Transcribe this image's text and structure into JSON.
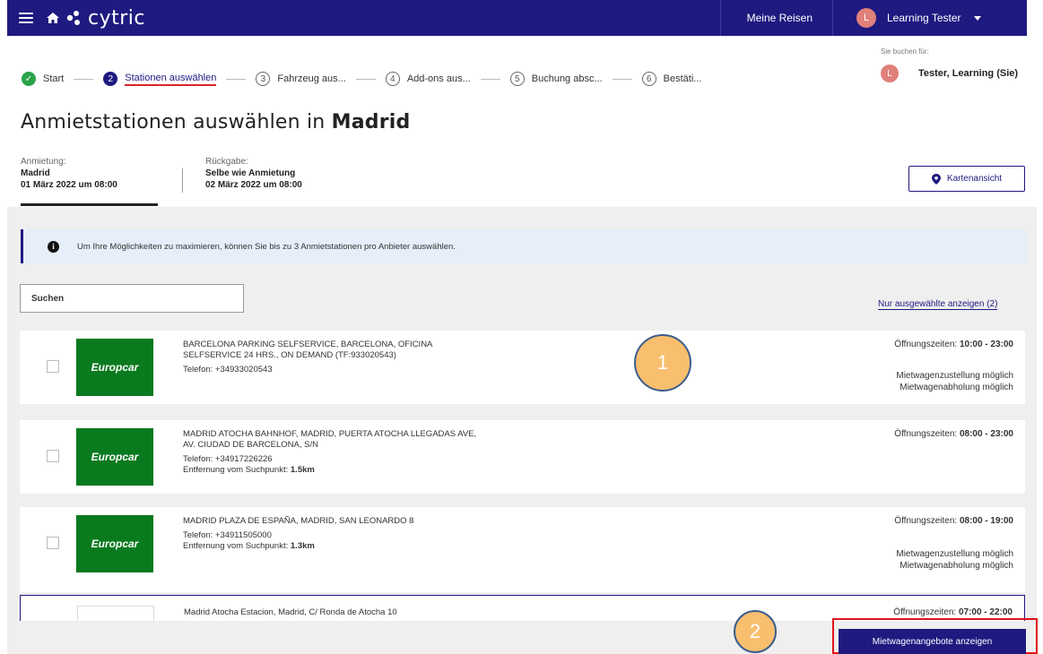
{
  "topbar": {
    "logo_text": "cytric",
    "trips_label": "Meine Reisen",
    "user_initial": "L",
    "user_name": "Learning Tester",
    "bg_color": "#1e1a80"
  },
  "stepper": {
    "steps": [
      {
        "num": "✓",
        "label": "Start",
        "state": "done"
      },
      {
        "num": "2",
        "label": "Stationen auswählen",
        "state": "active"
      },
      {
        "num": "3",
        "label": "Fahrzeug aus...",
        "state": "todo"
      },
      {
        "num": "4",
        "label": "Add-ons aus...",
        "state": "todo"
      },
      {
        "num": "5",
        "label": "Buchung absc...",
        "state": "todo"
      },
      {
        "num": "6",
        "label": "Bestäti...",
        "state": "todo"
      }
    ]
  },
  "booking_for": {
    "caption": "Sie buchen für:",
    "initial": "L",
    "name": "Tester, Learning (Sie)"
  },
  "page": {
    "title_prefix": "Anmietstationen auswählen in ",
    "title_city": "Madrid"
  },
  "rental": {
    "pickup_caption": "Anmietung:",
    "pickup_location": "Madrid",
    "pickup_datetime": "01 März 2022 um 08:00",
    "return_caption": "Rückgabe:",
    "return_location": "Selbe wie Anmietung",
    "return_datetime": "02 März 2022 um 08:00"
  },
  "map_button_label": "Kartenansicht",
  "info_text": "Um Ihre Möglichkeiten zu maximieren, können Sie bis zu 3 Anmietstationen pro Anbieter auswählen.",
  "search": {
    "placeholder": "Suchen"
  },
  "only_selected_label": "Nur ausgewählte anzeigen (2)",
  "hours_label": "Öffnungszeiten: ",
  "distance_label": "Entfernung vom Suchpunkt: ",
  "stations": [
    {
      "brand": "Europcar",
      "name_line1": "BARCELONA PARKING SELFSERVICE, BARCELONA, OFICINA",
      "name_line2": "SELFSERVICE 24 HRS., ON DEMAND (TF:933020543)",
      "phone": "Telefon: +34933020543",
      "distance": "",
      "hours": "10:00 - 23:00",
      "services": [
        "Mietwagenzustellung möglich",
        "Mietwagenabholung möglich"
      ]
    },
    {
      "brand": "Europcar",
      "name_line1": "MADRID ATOCHA BAHNHOF, MADRID, PUERTA ATOCHA LLEGADAS AVE,",
      "name_line2": "AV. CIUDAD DE BARCELONA, S/N",
      "phone": "Telefon: +34917226226",
      "distance": "1.5km",
      "hours": "08:00 - 23:00",
      "services": []
    },
    {
      "brand": "Europcar",
      "name_line1": "MADRID PLAZA DE ESPAÑA, MADRID, SAN LEONARDO 8",
      "name_line2": "",
      "phone": "Telefon: +34911505000",
      "distance": "1.3km",
      "hours": "08:00 - 19:00",
      "services": [
        "Mietwagenzustellung möglich",
        "Mietwagenabholung möglich"
      ]
    },
    {
      "brand": "",
      "name_line1": "Madrid Atocha Estacion, Madrid, C/ Ronda de Atocha 10",
      "name_line2": "",
      "phone": "",
      "distance": "",
      "hours": "07:00 - 22:00",
      "services": []
    }
  ],
  "markers": [
    "1",
    "2"
  ],
  "cta_label": "Mietwagenangebote anzeigen"
}
